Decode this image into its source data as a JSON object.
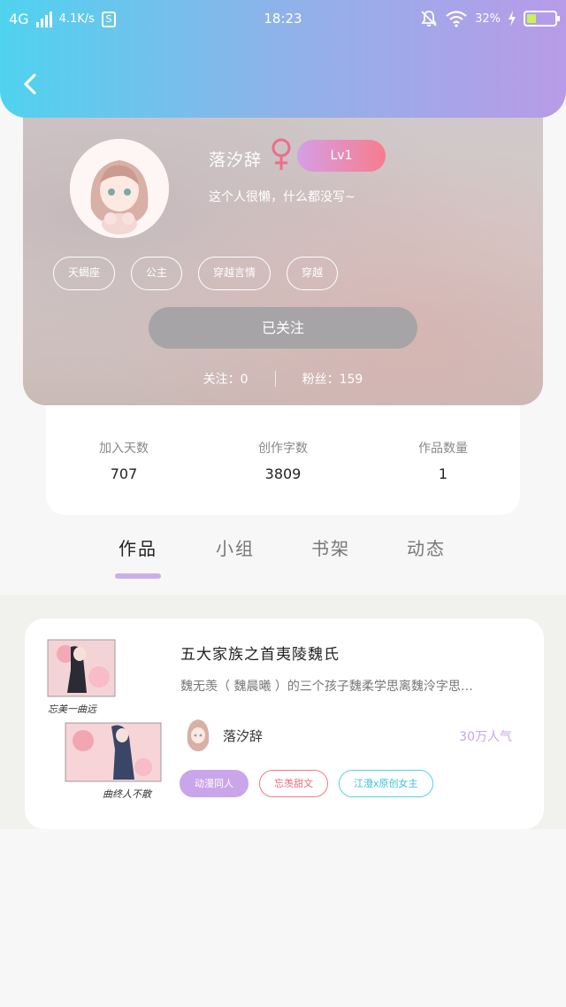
{
  "status_bar": {
    "network": "4G",
    "speed": "4.1K/s",
    "s_badge": "S",
    "time": "18:23",
    "battery_percent": "32%",
    "battery_level": 0.32
  },
  "profile": {
    "nickname": "落汐辞",
    "gender_icon": "female-icon",
    "level": "Lv1",
    "bio": "这个人很懒，什么都没写~",
    "tags": [
      "天蝎座",
      "公主",
      "穿越言情",
      "穿越"
    ],
    "follow_button": "已关注",
    "following": "关注：0",
    "fans": "粉丝：159"
  },
  "stats": [
    {
      "label": "加入天数",
      "value": "707"
    },
    {
      "label": "创作字数",
      "value": "3809"
    },
    {
      "label": "作品数量",
      "value": "1"
    }
  ],
  "tabs": [
    "作品",
    "小组",
    "书架",
    "动态"
  ],
  "active_tab": "作品",
  "work": {
    "title": "五大家族之首夷陵魏氏",
    "description": "魏无羡（ 魏晨曦 ）的三个孩子魏柔学思离魏泠字思…",
    "author": "落汐辞",
    "popularity": "30万人气",
    "tags": [
      "动漫同人",
      "忘羡甜文",
      "江澄x原创女主"
    ],
    "cover_calligraphy": [
      "忘美一曲远",
      "曲终人不散"
    ]
  },
  "colors": {
    "header_gradient": [
      "#4fd3ef",
      "#b89be8"
    ],
    "accent_purple": "#c9a6ea",
    "accent_pink": "#f77c8e",
    "accent_cyan": "#55d1e3"
  }
}
